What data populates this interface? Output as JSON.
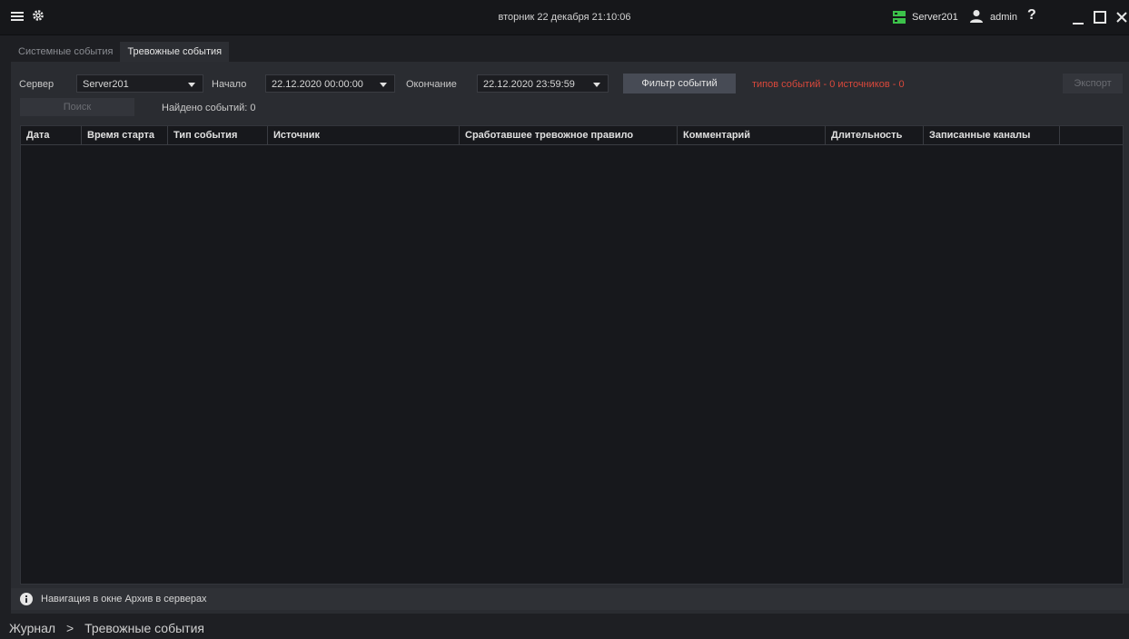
{
  "titlebar": {
    "datetime": "вторник 22 декабря 21:10:06",
    "server_name": "Server201",
    "user_name": "admin"
  },
  "tabs": [
    {
      "label": "Системные события",
      "active": false
    },
    {
      "label": "Тревожные события",
      "active": true
    }
  ],
  "filters": {
    "server_label": "Сервер",
    "server_value": "Server201",
    "start_label": "Начало",
    "start_value": "22.12.2020 00:00:00",
    "end_label": "Окончание",
    "end_value": "22.12.2020 23:59:59",
    "filter_button": "Фильтр событий",
    "filter_summary": "типов событий - 0 источников - 0",
    "export_button": "Экспорт",
    "search_button": "Поиск",
    "found_text": "Найдено событий: 0"
  },
  "table": {
    "columns": [
      "Дата",
      "Время старта",
      "Тип события",
      "Источник",
      "Сработавшее тревожное правило",
      "Комментарий",
      "Длительность",
      "Записанные каналы"
    ],
    "rows": []
  },
  "status": {
    "text": "Навигация в окне Архив в серверах"
  },
  "breadcrumb": {
    "root": "Журнал",
    "separator": ">",
    "current": "Тревожные события"
  },
  "colors": {
    "accent_red": "#d9483b",
    "server_green": "#3cc24a"
  }
}
